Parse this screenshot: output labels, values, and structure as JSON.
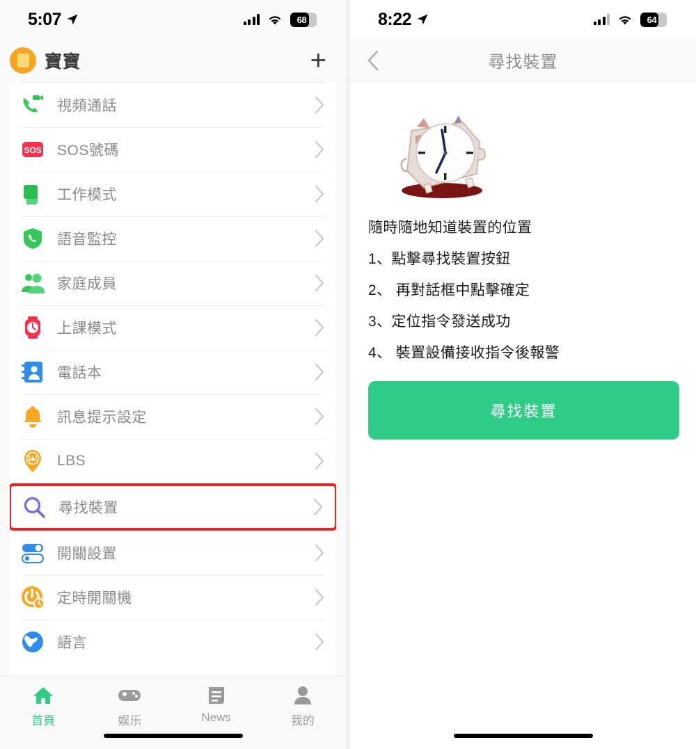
{
  "left": {
    "status": {
      "time": "5:07",
      "battery_pct": "68",
      "battery_level": 68,
      "location_icon": "location-arrow-icon",
      "signal_icon": "cellular-signal-icon",
      "wifi_icon": "wifi-icon"
    },
    "header": {
      "title": "寶寶",
      "avatar_icon": "watch-avatar-icon",
      "add_label": "+"
    },
    "menu_items": [
      {
        "label": "視頻通話",
        "icon": "video-call-icon"
      },
      {
        "label": "SOS號碼",
        "icon": "sos-icon"
      },
      {
        "label": "工作模式",
        "icon": "work-mode-icon"
      },
      {
        "label": "語音監控",
        "icon": "voice-monitor-icon"
      },
      {
        "label": "家庭成員",
        "icon": "family-members-icon"
      },
      {
        "label": "上課模式",
        "icon": "class-mode-watch-icon"
      },
      {
        "label": "電話本",
        "icon": "phonebook-icon"
      },
      {
        "label": "訊息提示設定",
        "icon": "bell-notification-icon"
      },
      {
        "label": "LBS",
        "icon": "lbs-location-pin-icon"
      },
      {
        "label": "尋找裝置",
        "icon": "search-device-icon",
        "highlighted": true
      },
      {
        "label": "開關設置",
        "icon": "toggle-switch-icon"
      },
      {
        "label": "定時開關機",
        "icon": "scheduled-power-icon"
      },
      {
        "label": "語言",
        "icon": "globe-language-icon"
      }
    ],
    "tabs": [
      {
        "label": "首頁",
        "icon": "home-icon",
        "active": true
      },
      {
        "label": "娱乐",
        "icon": "gamepad-icon",
        "active": false
      },
      {
        "label": "News",
        "icon": "news-icon",
        "active": false
      },
      {
        "label": "我的",
        "icon": "person-icon",
        "active": false
      }
    ]
  },
  "right": {
    "status": {
      "time": "8:22",
      "battery_pct": "64",
      "battery_level": 64,
      "location_icon": "location-arrow-icon",
      "signal_icon": "cellular-signal-icon",
      "wifi_icon": "wifi-icon"
    },
    "nav": {
      "title": "尋找裝置",
      "back_icon": "chevron-left-icon"
    },
    "illustration": "alarm-clock-illustration",
    "instructions": [
      "隨時隨地知道裝置的位置",
      "1、點擊尋找裝置按鈕",
      "2、 再對話框中點擊確定",
      "3、定位指令發送成功",
      "4、 裝置設備接收指令後報警"
    ],
    "action_button": {
      "label": "尋找裝置",
      "color": "#2ecc87"
    }
  },
  "colors": {
    "accent_green": "#2ecc87",
    "highlight_red": "#ee2222",
    "avatar_orange": "#f5a623",
    "label_gray": "#8a8a8a"
  }
}
